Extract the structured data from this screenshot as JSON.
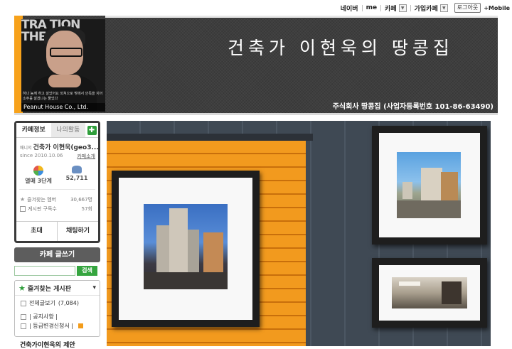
{
  "topnav": {
    "items": [
      "네이버",
      "me",
      "카페",
      "가입카페"
    ],
    "login": "로그아웃",
    "mobile": "+Mobile"
  },
  "header": {
    "title": "건축가 이현욱의 땅콩집",
    "company": "주식회사 땅콩집 (사업자등록번호 101-86-63490)",
    "photo_brand": "Peanut House Co., Ltd.",
    "photo_bgtext": "TRA TION THE",
    "photo_caption": "하나 농께 하고 살았어요 외쳐으로 밖에서 안독을 지어 소주를 살겠나는 물었다"
  },
  "sidebar": {
    "tab_info": "카페정보",
    "tab_activity": "나의활동",
    "owner_tag": "매니저",
    "owner_name": "건축가 이현욱(geo3...",
    "since": "since 2010.10.06",
    "intro": "카페소개",
    "level": "열매 3단계",
    "members": "52,711",
    "fav_members_label": "즐겨찾는 멤버",
    "fav_members_value": "30,667명",
    "board_subs_label": "게시판 구독수",
    "board_subs_value": "57회",
    "invite": "초대",
    "chat": "채팅하기",
    "write": "카페 글쓰기",
    "search_btn": "검색",
    "fav_boards": "즐겨찾는 게시판",
    "all_posts": "전체글보기",
    "all_posts_count": "(7,084)",
    "notice": "| 공지사항 |",
    "grade": "| 등급변경신청서 |",
    "proposal": "건축가이현욱의 제안"
  },
  "colors": {
    "accent_green": "#35a53f",
    "header_bg": "#3e3e3e",
    "orange": "#f29a1e"
  }
}
